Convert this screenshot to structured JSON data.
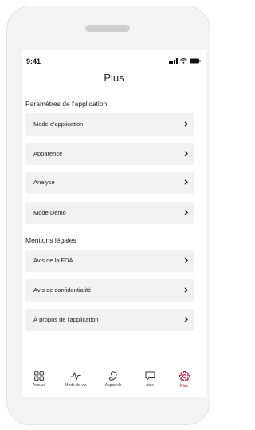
{
  "status": {
    "time": "9:41"
  },
  "header": {
    "title": "Plus"
  },
  "sections": [
    {
      "title": "Paramètres de l'application",
      "items": [
        {
          "label": "Mode d'application"
        },
        {
          "label": "Apparence"
        },
        {
          "label": "Analyse"
        },
        {
          "label": "Mode Démo"
        }
      ]
    },
    {
      "title": "Mentions légales",
      "items": [
        {
          "label": "Avis de la FDA"
        },
        {
          "label": "Avis de confidentialité"
        },
        {
          "label": "À propos de l'application"
        }
      ]
    }
  ],
  "tabs": [
    {
      "label": "Accueil",
      "icon": "grid-icon"
    },
    {
      "label": "Mode de vie",
      "icon": "activity-icon"
    },
    {
      "label": "Appareils",
      "icon": "hearing-aid-icon"
    },
    {
      "label": "Aide",
      "icon": "chat-bubble-icon"
    },
    {
      "label": "Plus",
      "icon": "gear-icon",
      "active": true
    }
  ],
  "colors": {
    "accent": "#c8102e",
    "row_bg": "#f2f2f2",
    "frame": "#f3f3f3"
  }
}
